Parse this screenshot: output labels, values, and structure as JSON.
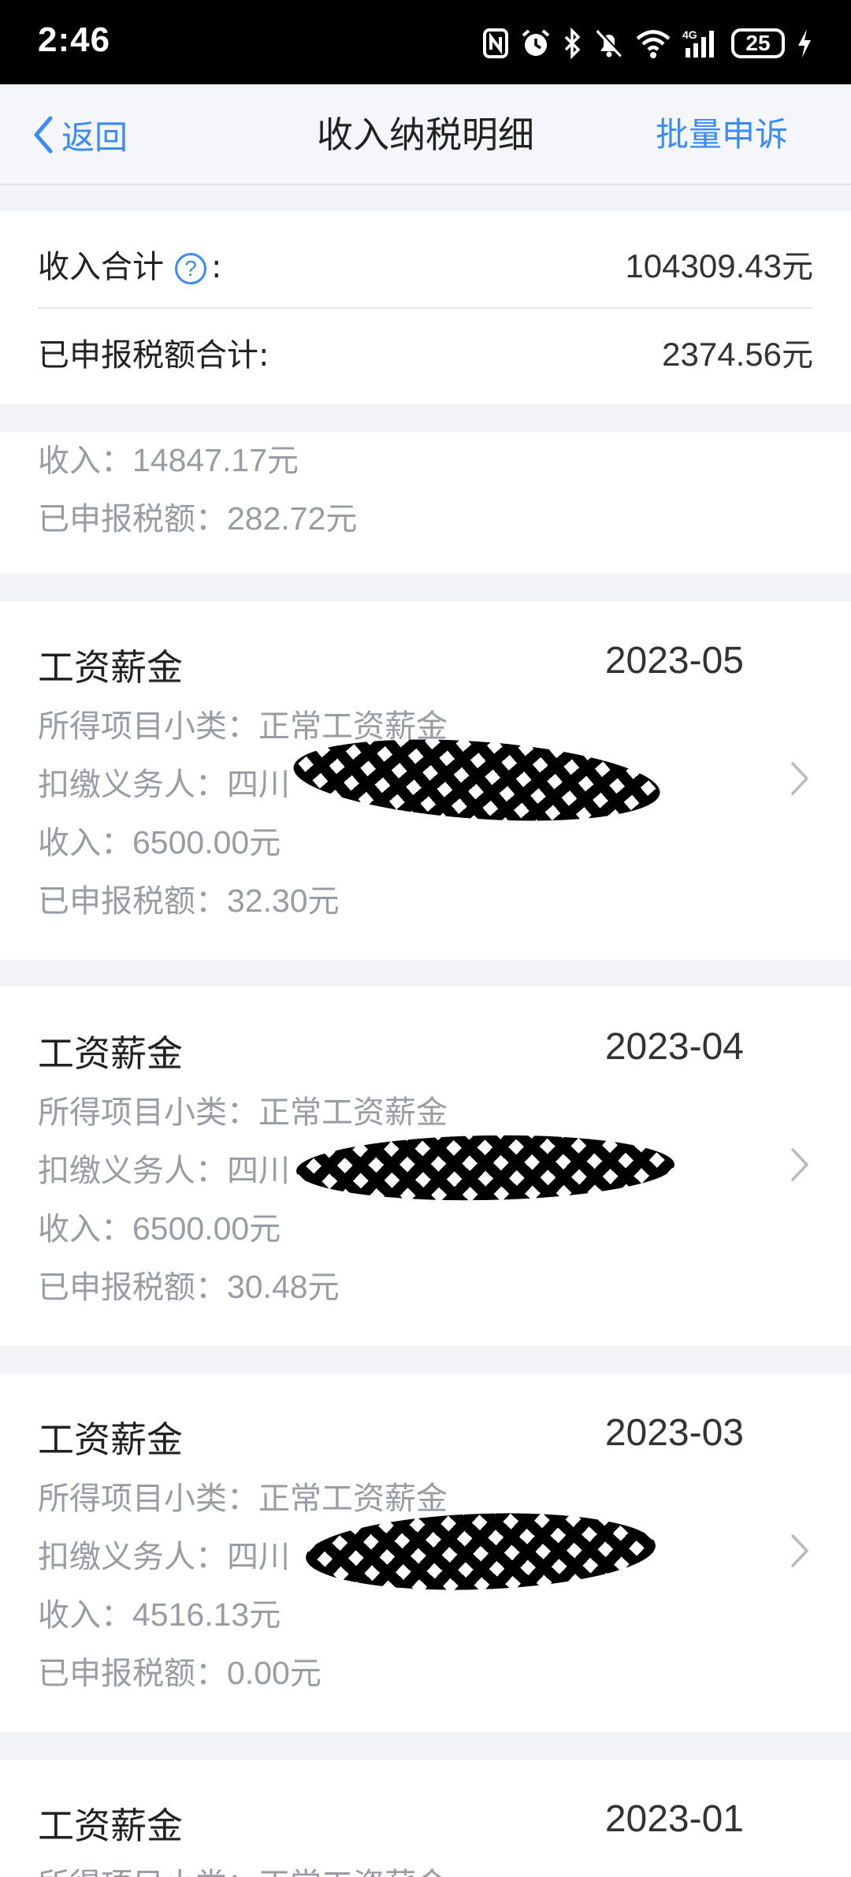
{
  "status_bar": {
    "time": "2:46",
    "battery": "25"
  },
  "nav": {
    "back_label": "返回",
    "title": "收入纳税明细",
    "action_label": "批量申诉"
  },
  "summary": {
    "income_label": "收入合计",
    "income_colon": ":",
    "help_glyph": "?",
    "income_value": "104309.43",
    "income_unit": "元",
    "tax_label": "已申报税额合计:",
    "tax_value": "2374.56",
    "tax_unit": "元"
  },
  "partial_card": {
    "income_label": "收入：",
    "income_value": "14847.17",
    "income_unit": "元",
    "tax_label": "已申报税额：",
    "tax_value": "282.72",
    "tax_unit": "元"
  },
  "records": [
    {
      "type": "工资薪金",
      "date": "2023-05",
      "subcategory_label": "所得项目小类：",
      "subcategory": "正常工资薪金",
      "withholder_label": "扣缴义务人：",
      "withholder_visible": "四川",
      "income_label": "收入：",
      "income": "6500.00",
      "income_unit": "元",
      "tax_label": "已申报税额：",
      "tax": "32.30",
      "tax_unit": "元"
    },
    {
      "type": "工资薪金",
      "date": "2023-04",
      "subcategory_label": "所得项目小类：",
      "subcategory": "正常工资薪金",
      "withholder_label": "扣缴义务人：",
      "withholder_visible": "四川",
      "income_label": "收入：",
      "income": "6500.00",
      "income_unit": "元",
      "tax_label": "已申报税额：",
      "tax": "30.48",
      "tax_unit": "元"
    },
    {
      "type": "工资薪金",
      "date": "2023-03",
      "subcategory_label": "所得项目小类：",
      "subcategory": "正常工资薪金",
      "withholder_label": "扣缴义务人：",
      "withholder_visible": "四川",
      "income_label": "收入：",
      "income": "4516.13",
      "income_unit": "元",
      "tax_label": "已申报税额：",
      "tax": "0.00",
      "tax_unit": "元"
    },
    {
      "type": "工资薪金",
      "date": "2023-01",
      "subcategory_label": "所得项目小类：",
      "subcategory": "正常工资薪金"
    }
  ],
  "colors": {
    "accent": "#3b8aff",
    "muted_text": "#9a9ca4",
    "page_bg": "#f3f4f8"
  }
}
